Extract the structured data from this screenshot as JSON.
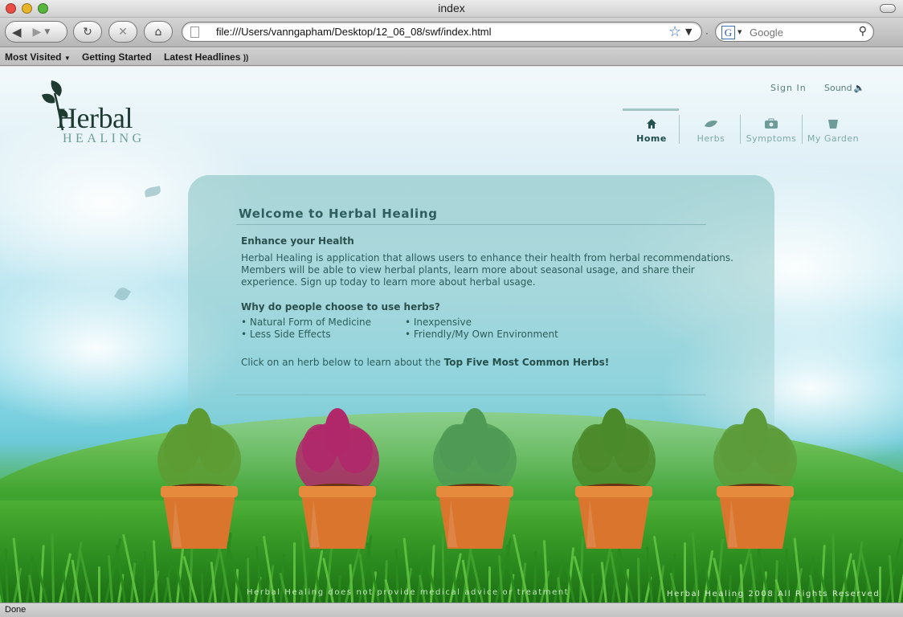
{
  "window": {
    "title": "index"
  },
  "toolbar": {
    "url": "file:///Users/vanngapham/Desktop/12_06_08/swf/index.html",
    "search_placeholder": "Google"
  },
  "bookmarks": [
    "Most Visited",
    "Getting Started",
    "Latest Headlines"
  ],
  "status": "Done",
  "site": {
    "logo_word": "Herbal",
    "logo_sub": "HEALING",
    "sign_in": "Sign In",
    "sound": "Sound",
    "nav": [
      "Home",
      "Herbs",
      "Symptoms",
      "My Garden"
    ],
    "nav_active": "Home",
    "welcome": {
      "title": "Welcome to Herbal Healing",
      "section1_heading": "Enhance your Health",
      "section1_body": [
        "Herbal Healing is application that allows users to enhance their health from herbal recommendations.",
        "Members will be able to view herbal plants, learn more about seasonal usage, and share their",
        "experience. Sign up today to learn more about herbal usage."
      ],
      "section2_heading": "Why do people choose to use herbs?",
      "reasons": [
        "• Natural Form of Medicine",
        "• Inexpensive",
        "• Less Side Effects",
        "• Friendly/My Own Environment"
      ],
      "cta_prefix": "Click on an herb below to learn about the ",
      "cta_bold": "Top Five Most Common Herbs!"
    },
    "footer_left": "Herbal Healing does not provide medical advice or treatment",
    "footer_right": "Herbal Healing 2008 All Rights Reserved"
  },
  "colors": {
    "accent": "#2e5f5e",
    "pot": "#d9752d",
    "grass": "#3ea32e"
  }
}
